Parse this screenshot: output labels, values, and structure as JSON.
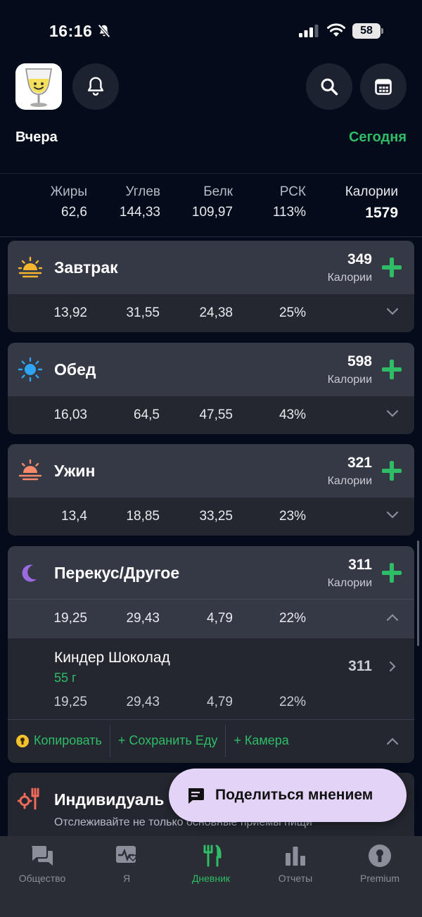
{
  "status_bar": {
    "time": "16:16",
    "battery": "58"
  },
  "header": {
    "prev_day": "Вчера",
    "today": "Сегодня"
  },
  "totals": {
    "fat": {
      "label": "Жиры",
      "value": "62,6"
    },
    "carbs": {
      "label": "Углев",
      "value": "144,33"
    },
    "protein": {
      "label": "Белк",
      "value": "109,97"
    },
    "rdi": {
      "label": "РСК",
      "value": "113%"
    },
    "calories": {
      "label": "Калории",
      "value": "1579"
    }
  },
  "meals": [
    {
      "title": "Завтрак",
      "calories": "349",
      "calories_label": "Калории",
      "fat": "13,92",
      "carbs": "31,55",
      "protein": "24,38",
      "rdi": "25%"
    },
    {
      "title": "Обед",
      "calories": "598",
      "calories_label": "Калории",
      "fat": "16,03",
      "carbs": "64,5",
      "protein": "47,55",
      "rdi": "43%"
    },
    {
      "title": "Ужин",
      "calories": "321",
      "calories_label": "Калории",
      "fat": "13,4",
      "carbs": "18,85",
      "protein": "33,25",
      "rdi": "23%"
    },
    {
      "title": "Перекус/Другое",
      "calories": "311",
      "calories_label": "Калории",
      "fat": "19,25",
      "carbs": "29,43",
      "protein": "4,79",
      "rdi": "22%",
      "items": [
        {
          "name": "Киндер Шоколад",
          "qty": "55 г",
          "calories": "311",
          "fat": "19,25",
          "carbs": "29,43",
          "protein": "4,79",
          "rdi": "22%"
        }
      ],
      "actions": {
        "copy": "Копировать",
        "save": "+ Сохранить Еду",
        "camera": "+ Камера"
      }
    }
  ],
  "custom_card": {
    "title": "Индивидуаль",
    "description": "Отслеживайте не только основные приемы пищи"
  },
  "feedback": {
    "label": "Поделиться мнением"
  },
  "tabs": [
    {
      "label": "Общество",
      "icon": "chat-icon"
    },
    {
      "label": "Я",
      "icon": "health-icon"
    },
    {
      "label": "Дневник",
      "icon": "fork-knife-icon"
    },
    {
      "label": "Отчеты",
      "icon": "bar-chart-icon"
    },
    {
      "label": "Premium",
      "icon": "keyhole-icon"
    }
  ],
  "colors": {
    "background": "#040b1a",
    "accent": "#2ebd66",
    "card": "#24272f",
    "card_header": "#353946",
    "feedback": "#e2d3f7"
  }
}
